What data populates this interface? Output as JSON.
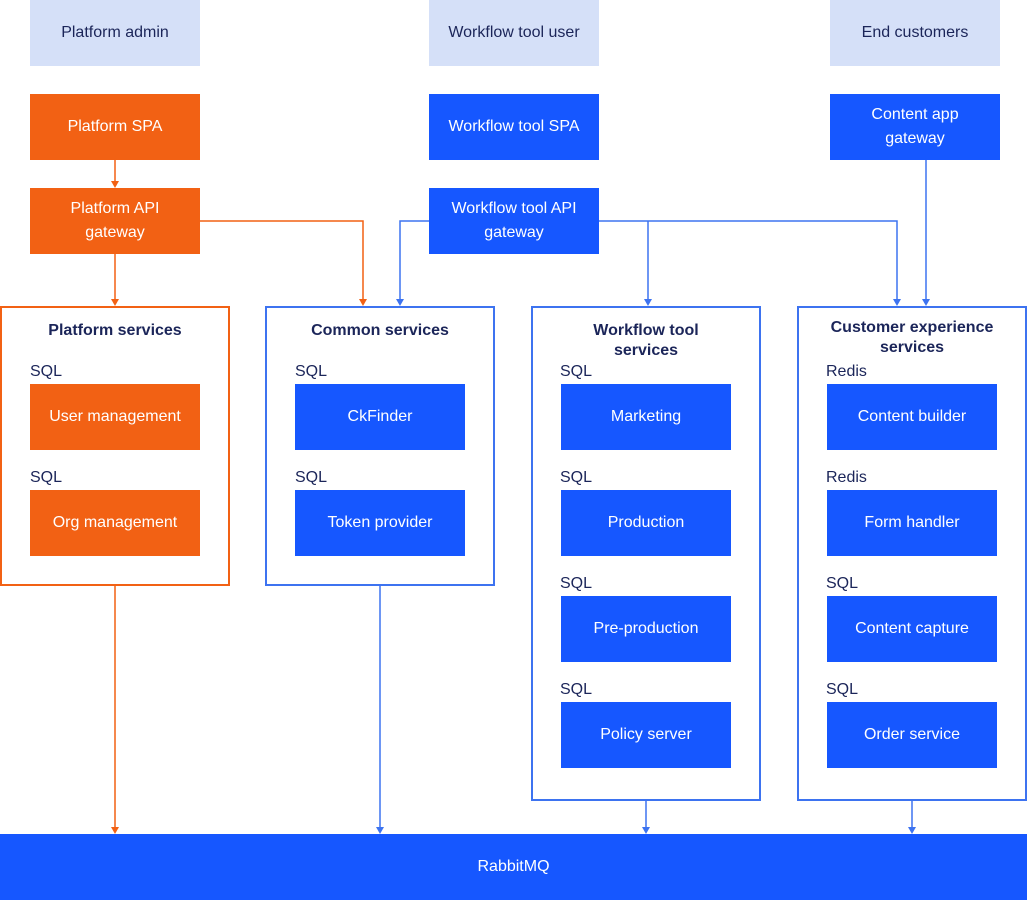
{
  "colors": {
    "orange": "#f26114",
    "blue": "#1657ff",
    "actor_bg": "#d5e0f8",
    "text_dark": "#1b2559"
  },
  "actors": {
    "platform_admin": "Platform admin",
    "workflow_user": "Workflow tool user",
    "end_customers": "End customers"
  },
  "frontends": {
    "platform_spa": "Platform SPA",
    "workflow_spa": "Workflow tool SPA",
    "content_gateway": "Content app gateway"
  },
  "gateways": {
    "platform_api": "Platform API gateway",
    "workflow_api": "Workflow tool API gateway"
  },
  "groups": {
    "platform": {
      "title": "Platform services",
      "items": [
        {
          "db": "SQL",
          "label": "User management"
        },
        {
          "db": "SQL",
          "label": "Org management"
        }
      ]
    },
    "common": {
      "title": "Common services",
      "items": [
        {
          "db": "SQL",
          "label": "CkFinder"
        },
        {
          "db": "SQL",
          "label": "Token provider"
        }
      ]
    },
    "workflow": {
      "title": "Workflow tool services",
      "items": [
        {
          "db": "SQL",
          "label": "Marketing"
        },
        {
          "db": "SQL",
          "label": "Production"
        },
        {
          "db": "SQL",
          "label": "Pre-production"
        },
        {
          "db": "SQL",
          "label": "Policy server"
        }
      ]
    },
    "cx": {
      "title": "Customer experience services",
      "items": [
        {
          "db": "Redis",
          "label": "Content builder"
        },
        {
          "db": "Redis",
          "label": "Form handler"
        },
        {
          "db": "SQL",
          "label": "Content capture"
        },
        {
          "db": "SQL",
          "label": "Order service"
        }
      ]
    }
  },
  "bus": {
    "label": "RabbitMQ"
  }
}
